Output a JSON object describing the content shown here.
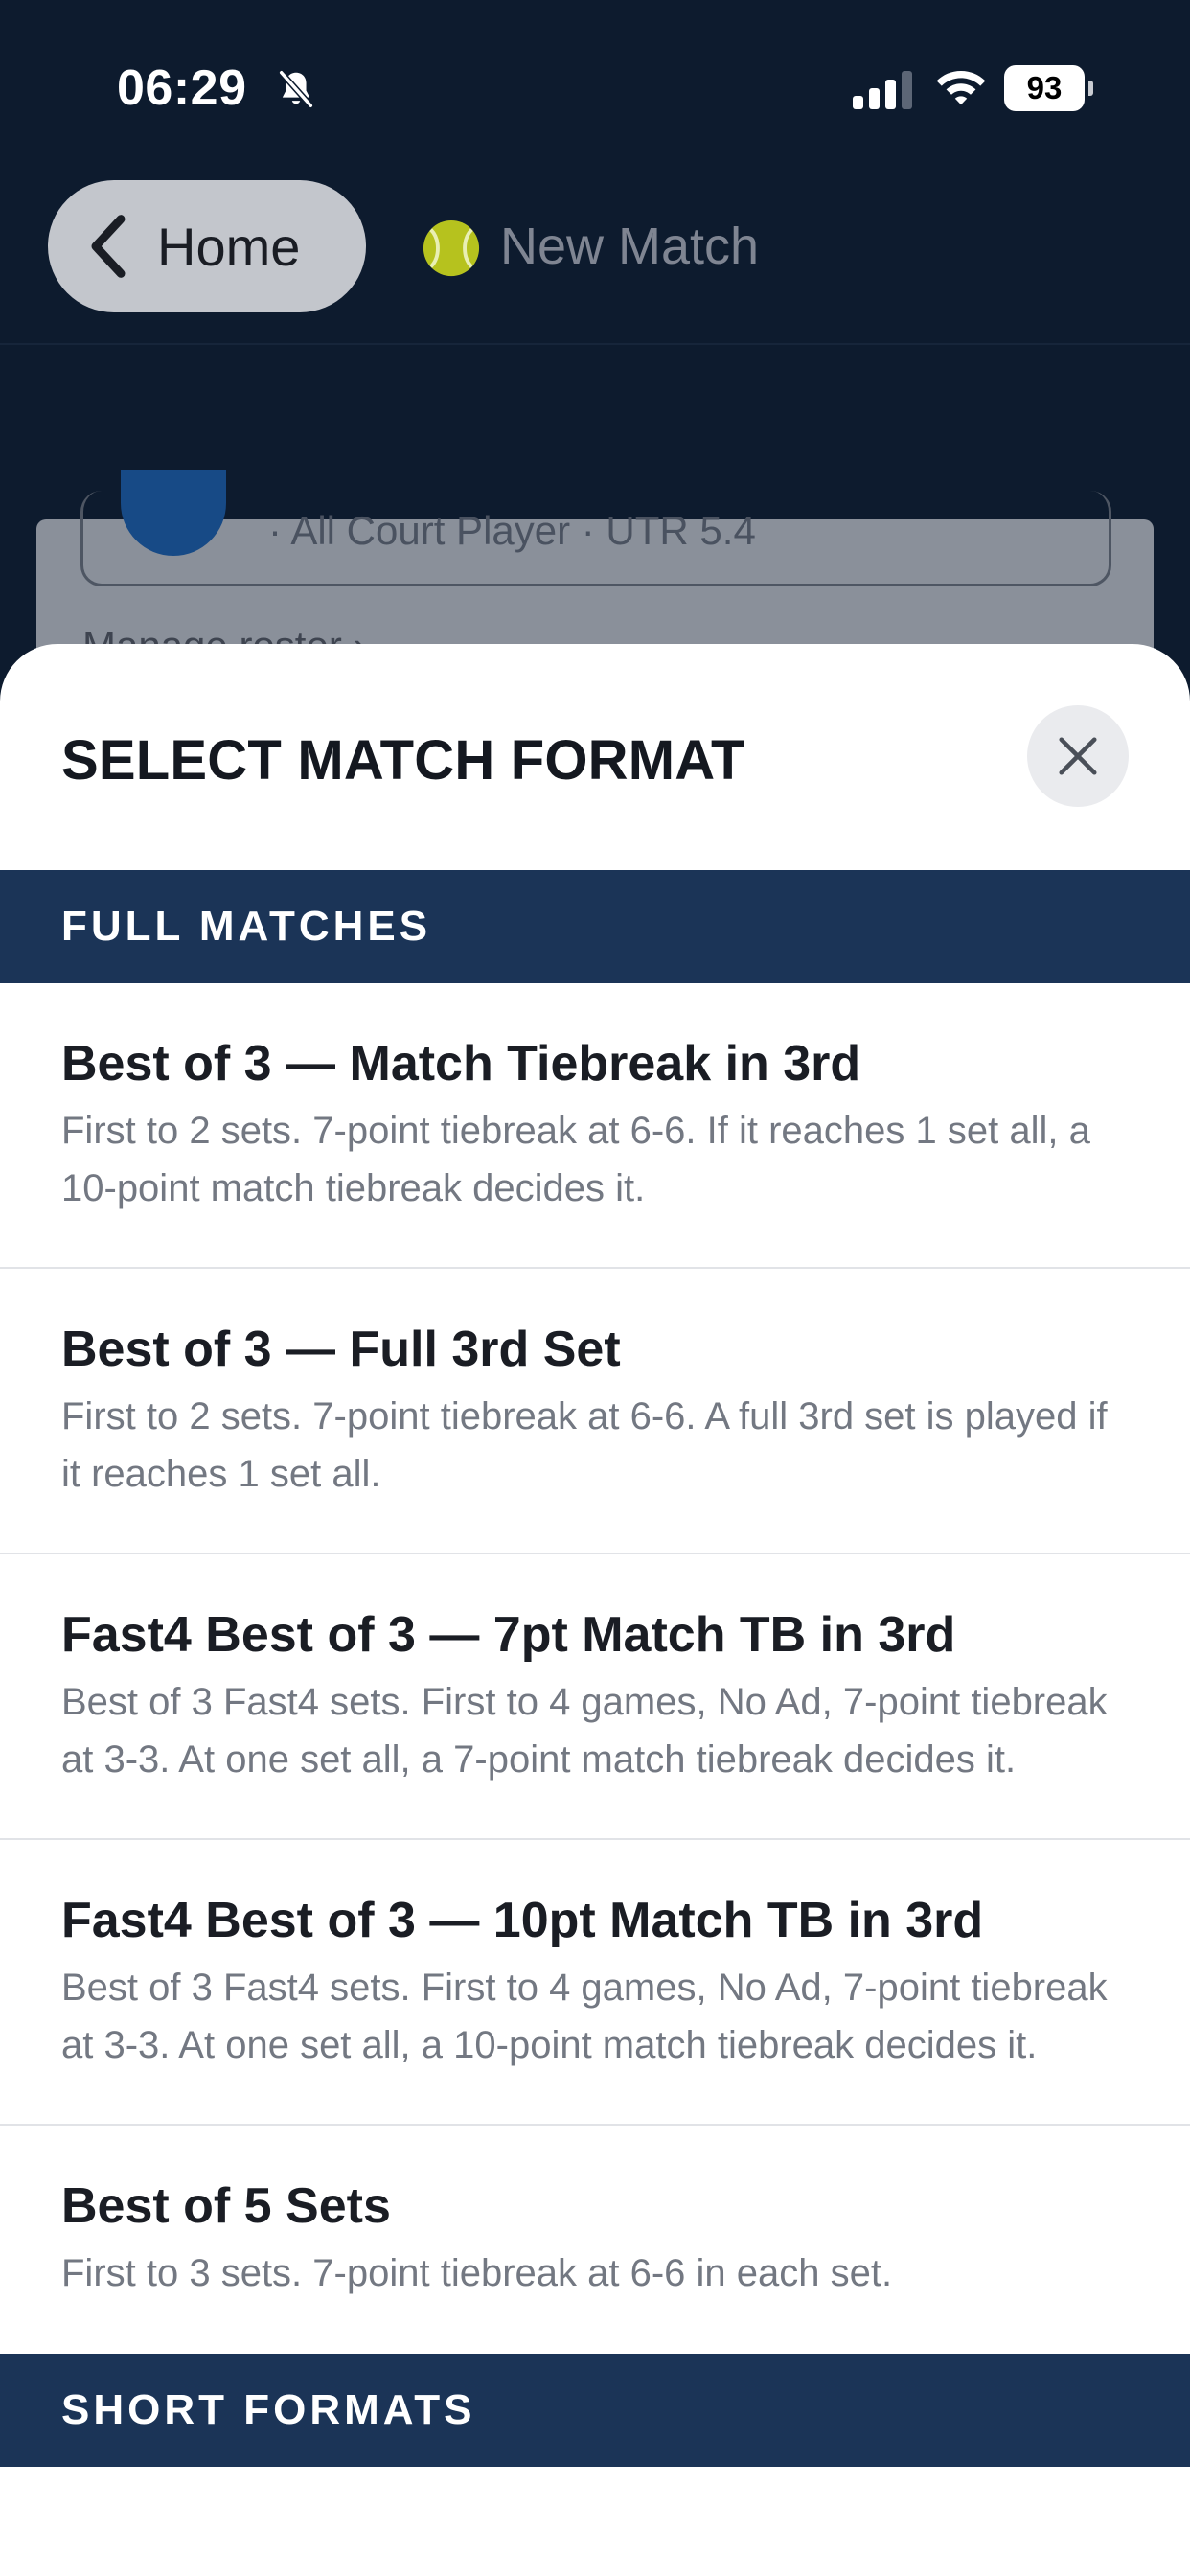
{
  "status_bar": {
    "time": "06:29",
    "battery": "93",
    "icons": [
      "bell-slash-icon",
      "cellular-signal-icon",
      "wifi-icon",
      "battery-icon"
    ]
  },
  "nav": {
    "back_label": "Home",
    "title": "New Match",
    "icons": [
      "chevron-left-icon",
      "tennis-ball-icon"
    ]
  },
  "background": {
    "player_subtitle": "· All Court Player · UTR 5.4",
    "link_text": "Manage roster ›"
  },
  "sheet": {
    "title": "SELECT MATCH FORMAT",
    "close_icon": "close-icon",
    "sections": [
      {
        "label": "FULL MATCHES",
        "items": [
          {
            "title": "Best of 3 — Match Tiebreak in 3rd",
            "description": "First to 2 sets. 7-point tiebreak at 6-6. If it reaches 1 set all, a 10-point match tiebreak decides it."
          },
          {
            "title": "Best of 3 — Full 3rd Set",
            "description": "First to 2 sets. 7-point tiebreak at 6-6. A full 3rd set is played if it reaches 1 set all."
          },
          {
            "title": "Fast4 Best of 3 — 7pt Match TB in 3rd",
            "description": "Best of 3 Fast4 sets. First to 4 games, No Ad, 7-point tiebreak at 3-3. At one set all, a 7-point match tiebreak decides it."
          },
          {
            "title": "Fast4 Best of 3 — 10pt Match TB in 3rd",
            "description": "Best of 3 Fast4 sets. First to 4 games, No Ad, 7-point tiebreak at 3-3. At one set all, a 10-point match tiebreak decides it."
          },
          {
            "title": "Best of 5 Sets",
            "description": "First to 3 sets. 7-point tiebreak at 6-6 in each set."
          }
        ]
      },
      {
        "label": "SHORT FORMATS",
        "items": []
      }
    ]
  },
  "colors": {
    "app_background": "#0d1b2e",
    "section_header": "#1b3457",
    "title_text": "#1a1d24",
    "description_text": "#737882"
  }
}
